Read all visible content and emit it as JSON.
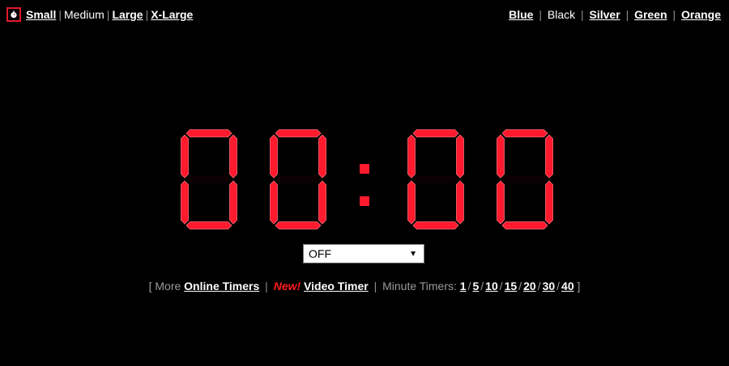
{
  "size_menu": {
    "logo_icon": "stopwatch-icon",
    "small": "Small",
    "medium": "Medium",
    "large": "Large",
    "xlarge": "X-Large"
  },
  "color_menu": {
    "blue": "Blue",
    "black": "Black",
    "silver": "Silver",
    "green": "Green",
    "orange": "Orange"
  },
  "timer": {
    "display": "00:00",
    "digit_color": "#ff1a2e"
  },
  "alarm_select": {
    "selected": "OFF"
  },
  "footer": {
    "open_bracket": "[ More",
    "online_timers": "Online Timers",
    "new_label": "New!",
    "video_timer": "Video Timer",
    "minute_timers_label": "Minute Timers:",
    "minute_links": [
      "1",
      "5",
      "10",
      "15",
      "20",
      "30",
      "40"
    ],
    "close_bracket": "]"
  }
}
